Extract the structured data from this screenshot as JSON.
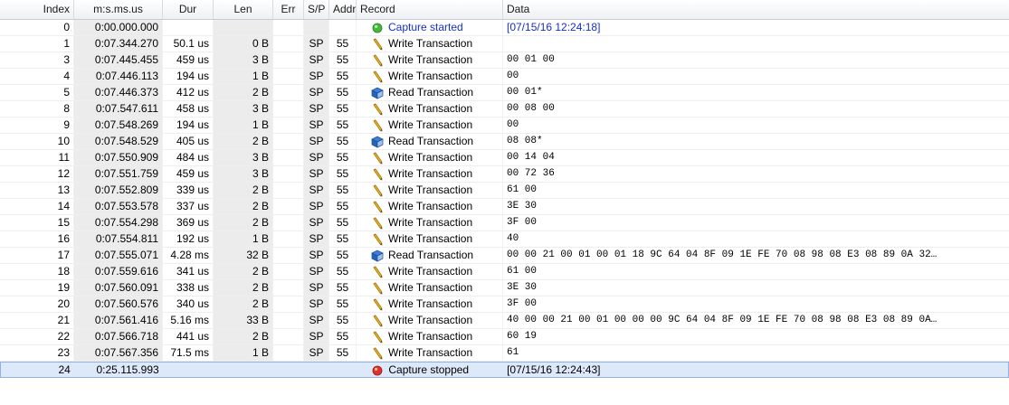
{
  "columns": [
    "Index",
    "m:s.ms.us",
    "Dur",
    "Len",
    "Err",
    "S/P",
    "Addr",
    "Record",
    "Data"
  ],
  "icons": {
    "write": "pencil-icon",
    "read": "book-icon",
    "started": "green-dot-icon",
    "stopped": "red-dot-icon"
  },
  "rows": [
    {
      "index": "0",
      "ts": "0:00.000.000",
      "dur": "",
      "len": "",
      "err": "",
      "sp": "",
      "addr": "",
      "icon": "started",
      "record": "Capture started",
      "data": "[07/15/16 12:24:18]",
      "info": true
    },
    {
      "index": "1",
      "ts": "0:07.344.270",
      "dur": "50.1 us",
      "len": "0 B",
      "err": "",
      "sp": "SP",
      "addr": "55",
      "icon": "write",
      "record": "Write Transaction",
      "data": ""
    },
    {
      "index": "3",
      "ts": "0:07.445.455",
      "dur": "459 us",
      "len": "3 B",
      "err": "",
      "sp": "SP",
      "addr": "55",
      "icon": "write",
      "record": "Write Transaction",
      "data": "00 01 00"
    },
    {
      "index": "4",
      "ts": "0:07.446.113",
      "dur": "194 us",
      "len": "1 B",
      "err": "",
      "sp": "SP",
      "addr": "55",
      "icon": "write",
      "record": "Write Transaction",
      "data": "00"
    },
    {
      "index": "5",
      "ts": "0:07.446.373",
      "dur": "412 us",
      "len": "2 B",
      "err": "",
      "sp": "SP",
      "addr": "55",
      "icon": "read",
      "record": "Read Transaction",
      "data": "00 01*"
    },
    {
      "index": "8",
      "ts": "0:07.547.611",
      "dur": "458 us",
      "len": "3 B",
      "err": "",
      "sp": "SP",
      "addr": "55",
      "icon": "write",
      "record": "Write Transaction",
      "data": "00 08 00"
    },
    {
      "index": "9",
      "ts": "0:07.548.269",
      "dur": "194 us",
      "len": "1 B",
      "err": "",
      "sp": "SP",
      "addr": "55",
      "icon": "write",
      "record": "Write Transaction",
      "data": "00"
    },
    {
      "index": "10",
      "ts": "0:07.548.529",
      "dur": "405 us",
      "len": "2 B",
      "err": "",
      "sp": "SP",
      "addr": "55",
      "icon": "read",
      "record": "Read Transaction",
      "data": "08 08*"
    },
    {
      "index": "11",
      "ts": "0:07.550.909",
      "dur": "484 us",
      "len": "3 B",
      "err": "",
      "sp": "SP",
      "addr": "55",
      "icon": "write",
      "record": "Write Transaction",
      "data": "00 14 04"
    },
    {
      "index": "12",
      "ts": "0:07.551.759",
      "dur": "459 us",
      "len": "3 B",
      "err": "",
      "sp": "SP",
      "addr": "55",
      "icon": "write",
      "record": "Write Transaction",
      "data": "00 72 36"
    },
    {
      "index": "13",
      "ts": "0:07.552.809",
      "dur": "339 us",
      "len": "2 B",
      "err": "",
      "sp": "SP",
      "addr": "55",
      "icon": "write",
      "record": "Write Transaction",
      "data": "61 00"
    },
    {
      "index": "14",
      "ts": "0:07.553.578",
      "dur": "337 us",
      "len": "2 B",
      "err": "",
      "sp": "SP",
      "addr": "55",
      "icon": "write",
      "record": "Write Transaction",
      "data": "3E 30"
    },
    {
      "index": "15",
      "ts": "0:07.554.298",
      "dur": "369 us",
      "len": "2 B",
      "err": "",
      "sp": "SP",
      "addr": "55",
      "icon": "write",
      "record": "Write Transaction",
      "data": "3F 00"
    },
    {
      "index": "16",
      "ts": "0:07.554.811",
      "dur": "192 us",
      "len": "1 B",
      "err": "",
      "sp": "SP",
      "addr": "55",
      "icon": "write",
      "record": "Write Transaction",
      "data": "40"
    },
    {
      "index": "17",
      "ts": "0:07.555.071",
      "dur": "4.28 ms",
      "len": "32 B",
      "err": "",
      "sp": "SP",
      "addr": "55",
      "icon": "read",
      "record": "Read Transaction",
      "data": "00 00 21 00 01 00 01 18 9C 64 04 8F 09 1E FE 70 08 98 08 E3 08 89 0A 32…"
    },
    {
      "index": "18",
      "ts": "0:07.559.616",
      "dur": "341 us",
      "len": "2 B",
      "err": "",
      "sp": "SP",
      "addr": "55",
      "icon": "write",
      "record": "Write Transaction",
      "data": "61 00"
    },
    {
      "index": "19",
      "ts": "0:07.560.091",
      "dur": "338 us",
      "len": "2 B",
      "err": "",
      "sp": "SP",
      "addr": "55",
      "icon": "write",
      "record": "Write Transaction",
      "data": "3E 30"
    },
    {
      "index": "20",
      "ts": "0:07.560.576",
      "dur": "340 us",
      "len": "2 B",
      "err": "",
      "sp": "SP",
      "addr": "55",
      "icon": "write",
      "record": "Write Transaction",
      "data": "3F 00"
    },
    {
      "index": "21",
      "ts": "0:07.561.416",
      "dur": "5.16 ms",
      "len": "33 B",
      "err": "",
      "sp": "SP",
      "addr": "55",
      "icon": "write",
      "record": "Write Transaction",
      "data": "40 00 00 21 00 01 00 00 00 9C 64 04 8F 09 1E FE 70 08 98 08 E3 08 89 0A…"
    },
    {
      "index": "22",
      "ts": "0:07.566.718",
      "dur": "441 us",
      "len": "2 B",
      "err": "",
      "sp": "SP",
      "addr": "55",
      "icon": "write",
      "record": "Write Transaction",
      "data": "60 19"
    },
    {
      "index": "23",
      "ts": "0:07.567.356",
      "dur": "71.5 ms",
      "len": "1 B",
      "err": "",
      "sp": "SP",
      "addr": "55",
      "icon": "write",
      "record": "Write Transaction",
      "data": "61"
    },
    {
      "index": "24",
      "ts": "0:25.115.993",
      "dur": "",
      "len": "",
      "err": "",
      "sp": "",
      "addr": "",
      "icon": "stopped",
      "record": "Capture stopped",
      "data": "[07/15/16 12:24:43]",
      "selected": true
    }
  ]
}
